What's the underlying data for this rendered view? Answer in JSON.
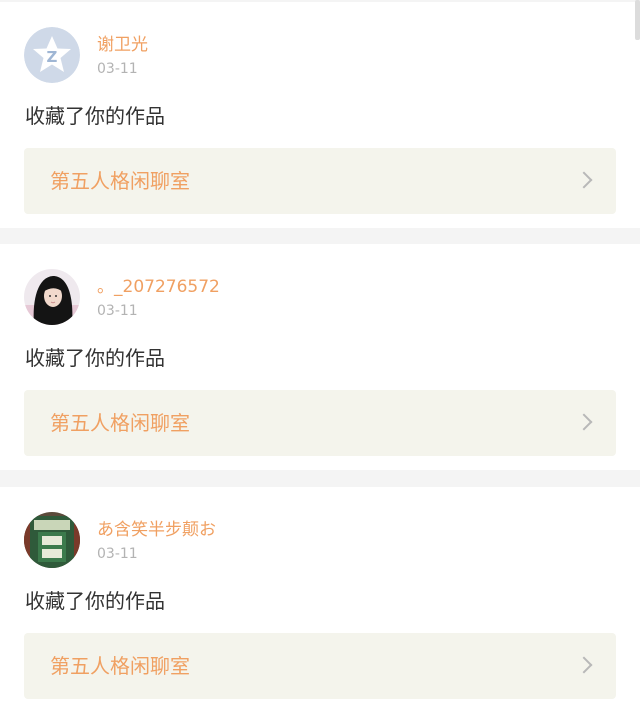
{
  "notifications": [
    {
      "username": "谢卫光",
      "time": "03-11",
      "action": "收藏了你的作品",
      "work_title": "第五人格闲聊室",
      "avatar_icon": "qq-default-avatar-icon"
    },
    {
      "username": "。_207276572",
      "time": "03-11",
      "action": "收藏了你的作品",
      "work_title": "第五人格闲聊室",
      "avatar_icon": "user-photo-girl-avatar"
    },
    {
      "username": "あ含笑半步颠お",
      "time": "03-11",
      "action": "收藏了你的作品",
      "work_title": "第五人格闲聊室",
      "avatar_icon": "user-photo-green-avatar"
    }
  ],
  "colors": {
    "accent": "#f0a062",
    "link_bg": "#f4f4ec",
    "text": "#333333",
    "muted": "#b3b3b3",
    "background": "#f4f4f4"
  }
}
